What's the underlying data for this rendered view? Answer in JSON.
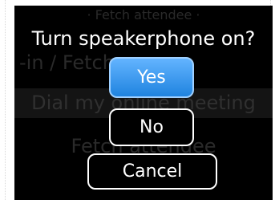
{
  "background_rows": [
    "· Fetch attendee ·",
    "-in / Fetch",
    "Dial my online meeting",
    "Fetch attendee"
  ],
  "dialog": {
    "title": "Turn speakerphone on?",
    "yes_label": "Yes",
    "no_label": "No",
    "cancel_label": "Cancel"
  },
  "colors": {
    "screen_background": "#000000",
    "selected_button_accent": "#3a97f0",
    "text": "#ffffff"
  }
}
